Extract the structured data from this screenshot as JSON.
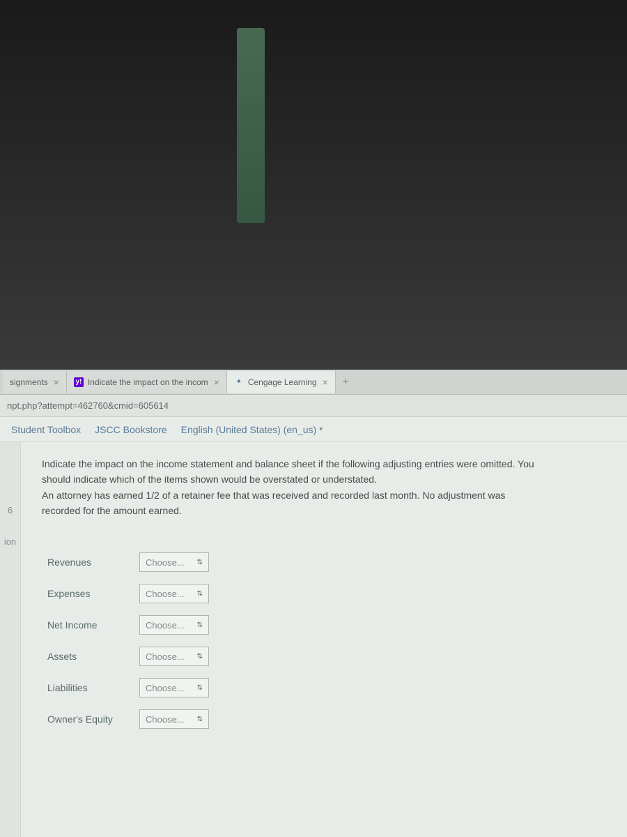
{
  "tabs": [
    {
      "label": "signments",
      "icon": ""
    },
    {
      "label": "Indicate the impact on the incom",
      "icon": "y!"
    },
    {
      "label": "Cengage Learning",
      "icon": "✦"
    }
  ],
  "close_symbol": "×",
  "add_symbol": "+",
  "url": "npt.php?attempt=462760&cmid=605614",
  "nav": {
    "toolbox": "Student Toolbox",
    "bookstore": "JSCC Bookstore",
    "language": "English (United States) (en_us)"
  },
  "sidebar": {
    "number": "6",
    "text": "ion"
  },
  "question": {
    "line1": "Indicate the impact on the income statement and balance sheet if the following adjusting entries were omitted. You",
    "line2": "should indicate which of the items shown would be overstated or understated.",
    "line3": "An attorney has earned 1/2 of a retainer fee that was received and recorded last month.   No adjustment was",
    "line4": "recorded for the amount earned."
  },
  "choose_placeholder": "Choose...",
  "answer_items": [
    {
      "label": "Revenues"
    },
    {
      "label": "Expenses"
    },
    {
      "label": "Net Income"
    },
    {
      "label": "Assets"
    },
    {
      "label": "Liabilities"
    },
    {
      "label": "Owner's Equity"
    }
  ],
  "select_arrow": "⇅"
}
